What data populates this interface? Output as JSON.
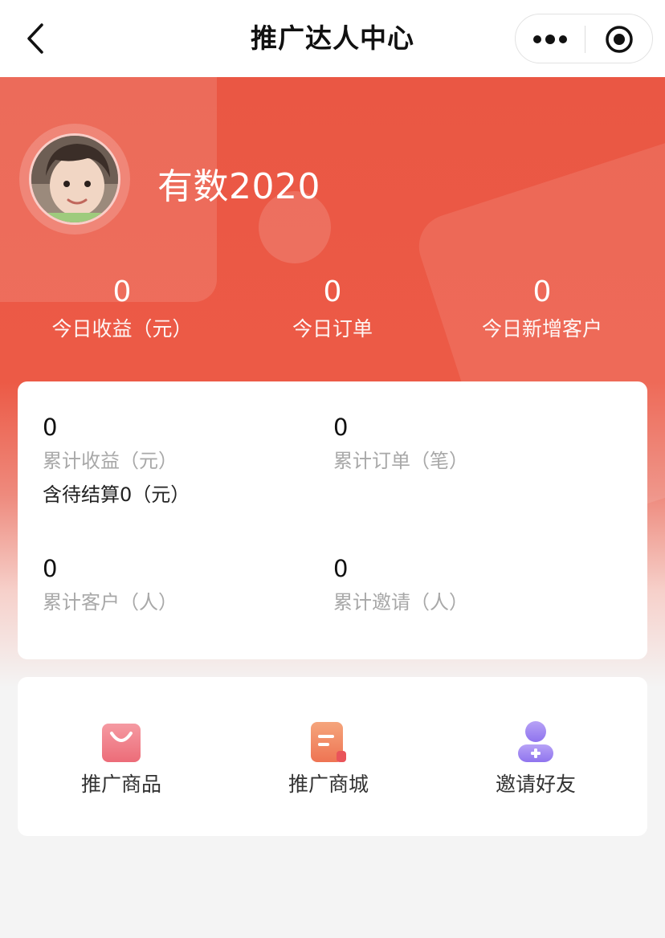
{
  "navbar": {
    "title": "推广达人中心",
    "back_icon": "chevron-left-icon",
    "more_icon": "more-dots-icon",
    "close_icon": "target-close-icon"
  },
  "profile": {
    "username": "有数2020",
    "avatar": "avatar-photo"
  },
  "today": [
    {
      "value": "0",
      "label": "今日收益（元）"
    },
    {
      "value": "0",
      "label": "今日订单"
    },
    {
      "value": "0",
      "label": "今日新增客户"
    }
  ],
  "totals": {
    "earnings": {
      "value": "0",
      "label": "累计收益（元）",
      "note": "含待结算0（元）"
    },
    "orders": {
      "value": "0",
      "label": "累计订单（笔）"
    },
    "customers": {
      "value": "0",
      "label": "累计客户（人）"
    },
    "invites": {
      "value": "0",
      "label": "累计邀请（人）"
    }
  },
  "actions": [
    {
      "label": "推广商品",
      "icon": "shopping-bag-icon",
      "color": "#ef7b86"
    },
    {
      "label": "推广商城",
      "icon": "document-icon",
      "color": "#f08a64"
    },
    {
      "label": "邀请好友",
      "icon": "add-user-icon",
      "color": "#9b82f0"
    }
  ],
  "colors": {
    "brand_red": "#ea5744",
    "background": "#f4f4f4"
  }
}
